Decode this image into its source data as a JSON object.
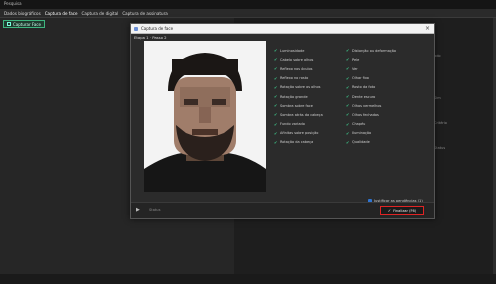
{
  "app": {
    "title": "Pesquisa"
  },
  "tabs": [
    {
      "label": "Dados biográficos"
    },
    {
      "label": "Captura de face"
    },
    {
      "label": "Captura de digital"
    },
    {
      "label": "Captura de assinatura"
    }
  ],
  "left_panel": {
    "capture_button": "Capturar Face"
  },
  "background_right": {
    "lines": [
      "Não identificado",
      "Sim",
      "Critério",
      "Status"
    ]
  },
  "modal": {
    "title": "Captura de face",
    "subtitle": "Etapa 1 · Passo 2",
    "checklist_col1": [
      "Luminosidade",
      "Cabelo sobre olhos",
      "Reflexo nos óculos",
      "Reflexo no rosto",
      "Rotação sobre os olhos",
      "Rotação grande",
      "Sombra sobre face",
      "Sombra atrás da cabeça",
      "Fundo variado",
      "Afinitas sobre posição",
      "Rotação da cabeça"
    ],
    "checklist_col2": [
      "Distorção ou deformação",
      "Pele",
      "Ver",
      "Olhar fixo",
      "Rosto da foto",
      "Dente escuro",
      "Olhos vermelhos",
      "Olhos fechados",
      "Chapéu",
      "Iluminação",
      "Qualidade"
    ],
    "footer_checkbox_label": "Justificar as pendências (1)",
    "control_label": "Status",
    "finalize_label": "Finalizar (F6)"
  },
  "colors": {
    "accent_green": "#3fcf8f",
    "highlight_red": "#e02424",
    "checkbox_blue": "#2f74d0"
  }
}
